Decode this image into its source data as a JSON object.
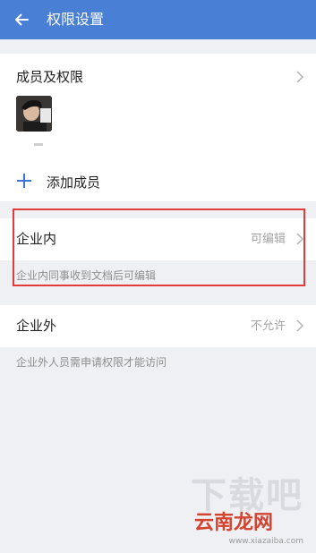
{
  "appbar": {
    "title": "权限设置"
  },
  "members": {
    "title": "成员及权限",
    "add_label": "添加成员"
  },
  "internal": {
    "title": "企业内",
    "value": "可编辑",
    "description": "企业内同事收到文档后可编辑"
  },
  "external": {
    "title": "企业外",
    "value": "不允许",
    "description": "企业外人员需申请权限才能访问"
  },
  "icons": {
    "back": "arrow-left-icon",
    "chevron": "chevron-right-icon",
    "add": "plus-icon"
  },
  "colors": {
    "appbar": "#4a7fd6",
    "accent": "#3b73d9",
    "highlight": "#e23b3b",
    "background": "#eef0f4"
  },
  "watermark": {
    "big": "下载吧",
    "brand": "云南龙网",
    "url": "www.xiazaiba.com"
  }
}
